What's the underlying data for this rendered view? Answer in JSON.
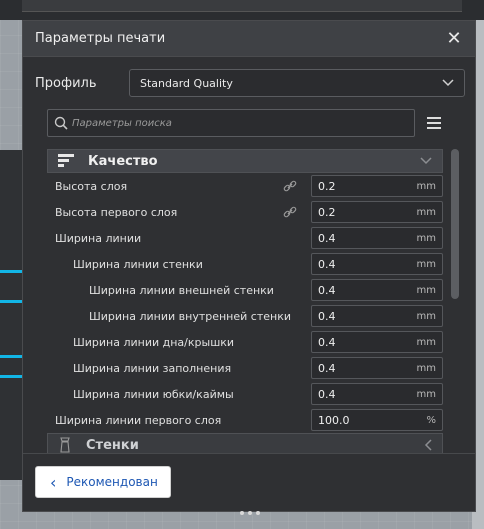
{
  "dialog": {
    "title": "Параметры печати",
    "close_symbol": "✕"
  },
  "profile": {
    "label": "Профиль",
    "selected": "Standard Quality"
  },
  "search": {
    "placeholder": "Параметры поиска"
  },
  "categories": {
    "quality": {
      "label": "Качество",
      "icon": "quality-icon",
      "expanded": true
    },
    "walls": {
      "label": "Стенки",
      "icon": "walls-icon",
      "expanded": false
    }
  },
  "settings": [
    {
      "label": "Высота слоя",
      "value": "0.2",
      "unit": "mm",
      "linked": true
    },
    {
      "label": "Высота первого слоя",
      "value": "0.2",
      "unit": "mm",
      "linked": true
    },
    {
      "label": "Ширина линии",
      "value": "0.4",
      "unit": "mm",
      "linked": false
    },
    {
      "label": "Ширина линии стенки",
      "value": "0.4",
      "unit": "mm",
      "linked": false
    },
    {
      "label": "Ширина линии внешней стенки",
      "value": "0.4",
      "unit": "mm",
      "linked": false
    },
    {
      "label": "Ширина линии внутренней стенки",
      "value": "0.4",
      "unit": "mm",
      "linked": false
    },
    {
      "label": "Ширина линии дна/крышки",
      "value": "0.4",
      "unit": "mm",
      "linked": false
    },
    {
      "label": "Ширина линии заполнения",
      "value": "0.4",
      "unit": "mm",
      "linked": false
    },
    {
      "label": "Ширина линии юбки/каймы",
      "value": "0.4",
      "unit": "mm",
      "linked": false
    },
    {
      "label": "Ширина линии первого слоя",
      "value": "100.0",
      "unit": "%",
      "linked": false
    }
  ],
  "footer": {
    "recommended_label": "Рекомендован"
  },
  "colors": {
    "accent": "#1d57b3",
    "viewport_model_highlight": "#12b6e6"
  }
}
